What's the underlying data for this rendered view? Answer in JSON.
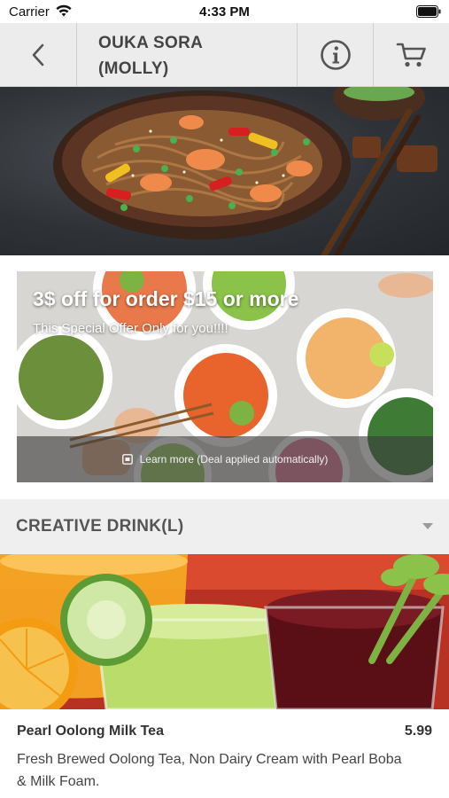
{
  "status_bar": {
    "carrier": "Carrier",
    "time": "4:33 PM",
    "icons": [
      "wifi-icon",
      "battery-icon"
    ]
  },
  "nav": {
    "title_line1": "OUKA SORA",
    "title_line2": "(MOLLY)",
    "icons": [
      "chevron-left-icon",
      "info-icon",
      "cart-icon"
    ]
  },
  "promo": {
    "title": "3$ off for order $15 or more",
    "subtitle": "This Special Offer Only for you!!!!",
    "footer_text": "Learn more (Deal applied automatically)"
  },
  "category": {
    "title": "CREATIVE DRINK(L)"
  },
  "product": {
    "name": "Pearl Oolong Milk Tea",
    "price": "5.99",
    "description": "Fresh Brewed Oolong Tea, Non Dairy Cream with Pearl Boba & Milk Foam."
  },
  "colors": {
    "nav_background": "#ececec",
    "category_background": "#efefef",
    "text_primary": "#333333"
  }
}
